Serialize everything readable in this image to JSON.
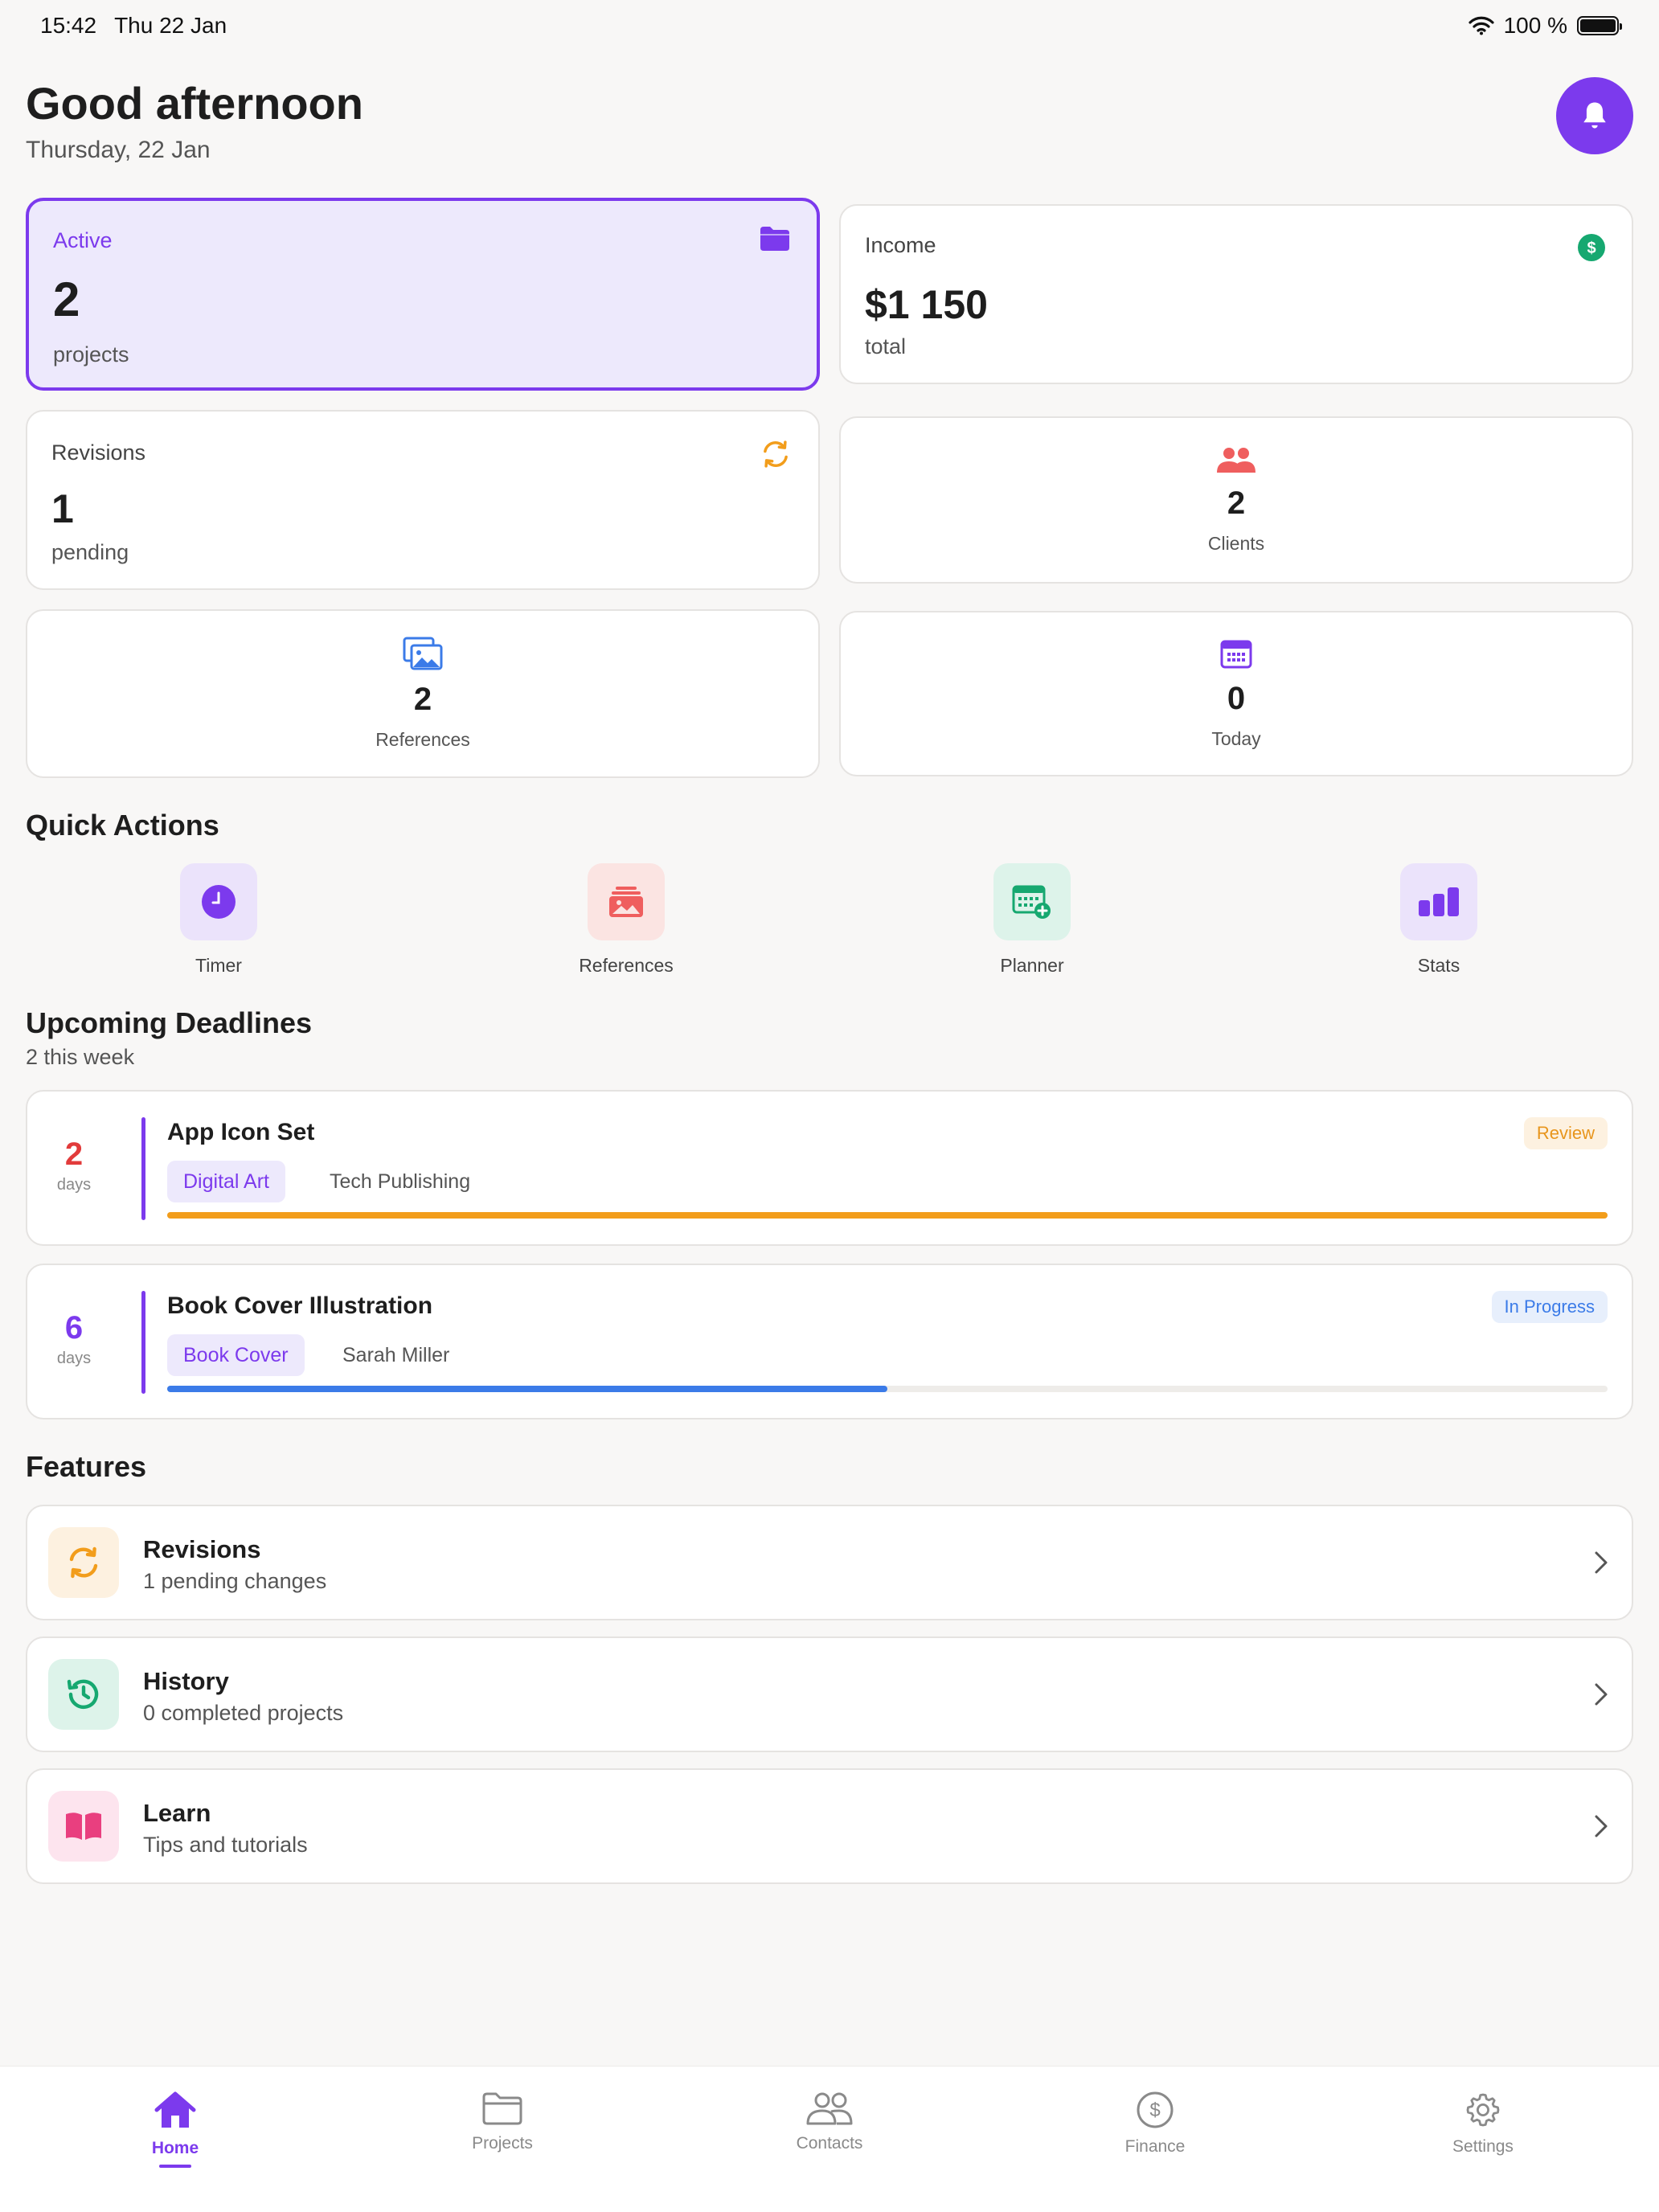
{
  "status_bar": {
    "time": "15:42",
    "date": "Thu 22 Jan",
    "battery": "100 %"
  },
  "header": {
    "greeting": "Good afternoon",
    "date": "Thursday, 22 Jan"
  },
  "stats": {
    "active": {
      "label": "Active",
      "value": "2",
      "sub": "projects"
    },
    "income": {
      "label": "Income",
      "value": "$1 150",
      "sub": "total"
    },
    "revisions": {
      "label": "Revisions",
      "value": "1",
      "sub": "pending"
    },
    "clients": {
      "value": "2",
      "label": "Clients"
    },
    "references": {
      "value": "2",
      "label": "References"
    },
    "today": {
      "value": "0",
      "label": "Today"
    }
  },
  "quick_actions": {
    "title": "Quick Actions",
    "items": [
      {
        "label": "Timer",
        "icon": "clock-icon"
      },
      {
        "label": "References",
        "icon": "image-stack-icon"
      },
      {
        "label": "Planner",
        "icon": "calendar-plus-icon"
      },
      {
        "label": "Stats",
        "icon": "bar-chart-icon"
      }
    ]
  },
  "deadlines": {
    "title": "Upcoming Deadlines",
    "subtitle": "2 this week",
    "items": [
      {
        "days": "2",
        "unit": "days",
        "title": "App Icon Set",
        "tag": "Digital Art",
        "client": "Tech Publishing",
        "status": "Review",
        "progress": 1.0,
        "days_color": "#e23b3b",
        "status_bg": "#fdf1e0",
        "status_color": "#e8951c",
        "bar_color": "#f29d1b"
      },
      {
        "days": "6",
        "unit": "days",
        "title": "Book Cover Illustration",
        "tag": "Book Cover",
        "client": "Sarah Miller",
        "status": "In Progress",
        "progress": 0.5,
        "days_color": "#7c3aed",
        "status_bg": "#e7effc",
        "status_color": "#3b7be8",
        "bar_color": "#3b7be8"
      }
    ]
  },
  "features": {
    "title": "Features",
    "items": [
      {
        "title": "Revisions",
        "sub": "1 pending changes",
        "icon": "refresh-icon"
      },
      {
        "title": "History",
        "sub": "0 completed projects",
        "icon": "history-icon"
      },
      {
        "title": "Learn",
        "sub": "Tips and tutorials",
        "icon": "book-icon"
      }
    ]
  },
  "tab_bar": {
    "items": [
      {
        "label": "Home",
        "icon": "home-icon",
        "active": true
      },
      {
        "label": "Projects",
        "icon": "folder-icon"
      },
      {
        "label": "Contacts",
        "icon": "people-icon"
      },
      {
        "label": "Finance",
        "icon": "dollar-circle-icon"
      },
      {
        "label": "Settings",
        "icon": "gear-icon"
      }
    ]
  },
  "colors": {
    "accent": "#7c3aed",
    "background": "#f8f7f6"
  }
}
